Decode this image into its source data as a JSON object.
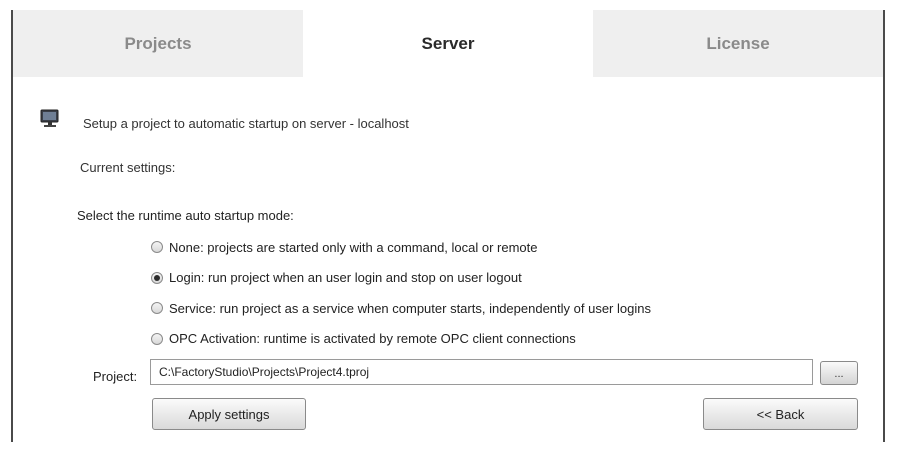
{
  "tabs": [
    {
      "label": "Projects",
      "active": false
    },
    {
      "label": "Server",
      "active": true
    },
    {
      "label": "License",
      "active": false
    }
  ],
  "header": {
    "text": "Setup a project to automatic startup on server - localhost",
    "icon": "monitor-icon"
  },
  "current_settings_label": "Current settings:",
  "mode_prompt": "Select the runtime auto startup mode:",
  "options": [
    {
      "label": "None: projects are started only with a command, local or remote",
      "checked": false
    },
    {
      "label": "Login: run project when an user login and stop on user logout",
      "checked": true
    },
    {
      "label": "Service: run project as a service when computer starts, independently of user logins",
      "checked": false
    },
    {
      "label": "OPC Activation: runtime is activated by remote OPC client connections",
      "checked": false
    }
  ],
  "project": {
    "label": "Project:",
    "value": "C:\\FactoryStudio\\Projects\\Project4.tproj",
    "browse_label": "..."
  },
  "buttons": {
    "apply": "Apply settings",
    "back": "<< Back"
  }
}
